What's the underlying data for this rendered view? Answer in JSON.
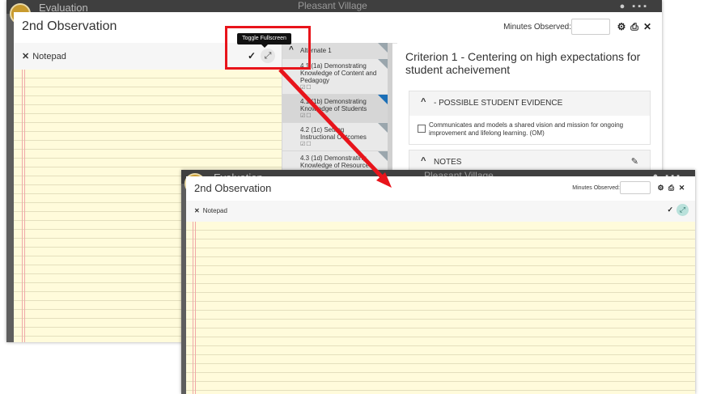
{
  "colors": {
    "highlight": "#e8141b",
    "paper": "#fffbdb",
    "fullscreen_active": "#b9e1db",
    "alt_flag_blue": "#1b6fb7"
  },
  "background": {
    "district_name": "Pleasant Village",
    "app_title_fragment": "Evaluation"
  },
  "modal": {
    "title": "2nd Observation",
    "minutes_label": "Minutes Observed:",
    "minutes_value": "",
    "icons": [
      "gear-icon",
      "print-icon",
      "close-icon"
    ]
  },
  "notepad": {
    "title": "Notepad",
    "close_icon": "close-icon",
    "save_icon": "check-icon",
    "fullscreen_icon": "expand-icon"
  },
  "tooltip": {
    "text": "Toggle Fullscreen"
  },
  "alternate": {
    "header": "Alternate 1",
    "items": [
      {
        "label": "4.1 (1a) Demonstrating Knowledge of Content and Pedagogy",
        "flag": "gray"
      },
      {
        "label": "4.1 (1b) Demonstrating Knowledge of Students",
        "flag": "blue"
      },
      {
        "label": "4.2 (1c) Setting Instructional Outcomes",
        "flag": "gray"
      },
      {
        "label": "4.3 (1d) Demonstrating Knowledge of Resources",
        "flag": "gray"
      }
    ]
  },
  "criterion": {
    "title": "Criterion 1 - Centering on high expectations for student acheivement",
    "evidence_header": "- POSSIBLE STUDENT EVIDENCE",
    "evidence_item": "Communicates and models a shared vision and mission for ongoing improvement and lifelong learning. (OM)",
    "notes_header": "NOTES"
  }
}
